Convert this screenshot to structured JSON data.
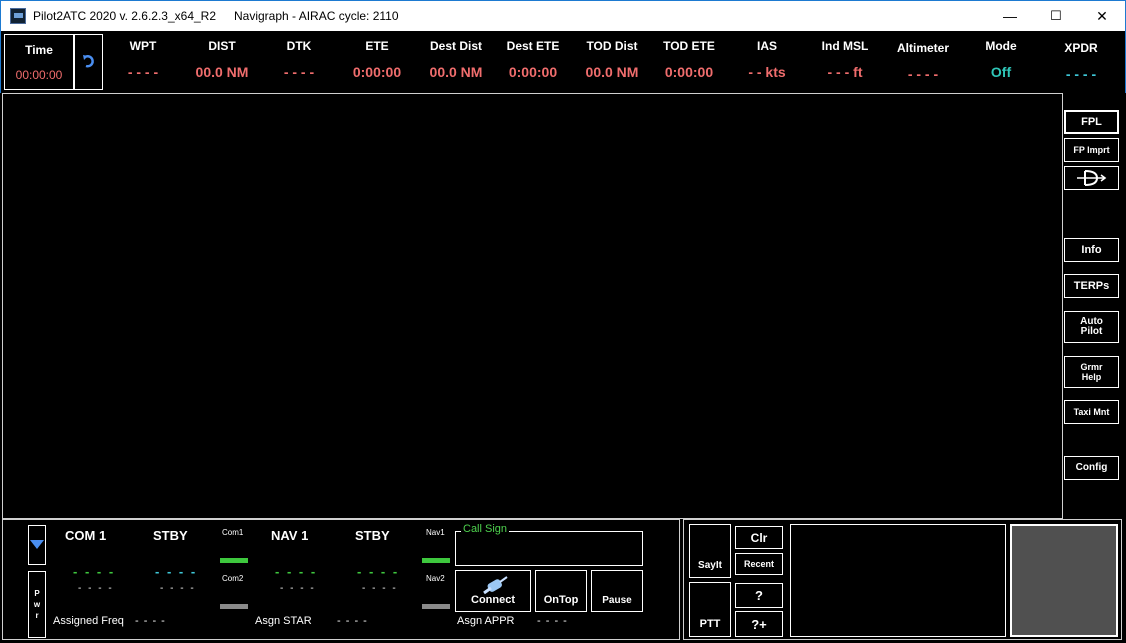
{
  "window": {
    "title": "Pilot2ATC 2020 v. 2.6.2.3_x64_R2",
    "subtitle": "Navigraph - AIRAC cycle: 2110",
    "minimize": "—",
    "maximize": "☐",
    "close": "✕"
  },
  "colors": {
    "value_red": "#f06d6d",
    "teal": "#2fc6b8",
    "green": "#3ec83e",
    "cyan": "#3ec8d8"
  },
  "instruments": {
    "time": {
      "label": "Time",
      "value": "00:00:00"
    },
    "refresh_icon": "refresh-icon",
    "columns": [
      {
        "key": "wpt",
        "label": "WPT",
        "value": "- - - -"
      },
      {
        "key": "dist",
        "label": "DIST",
        "value": "00.0 NM"
      },
      {
        "key": "dtk",
        "label": "DTK",
        "value": "- - - -"
      },
      {
        "key": "ete",
        "label": "ETE",
        "value": "0:00:00"
      },
      {
        "key": "dest-dist",
        "label": "Dest Dist",
        "value": "00.0 NM"
      },
      {
        "key": "dest-ete",
        "label": "Dest ETE",
        "value": "0:00:00"
      },
      {
        "key": "tod-dist",
        "label": "TOD Dist",
        "value": "00.0 NM"
      },
      {
        "key": "tod-ete",
        "label": "TOD ETE",
        "value": "0:00:00"
      },
      {
        "key": "ias",
        "label": "IAS",
        "value": "- - kts"
      },
      {
        "key": "ind-msl",
        "label": "Ind MSL",
        "value": "- - - ft"
      },
      {
        "key": "altimeter",
        "label": "Altimeter",
        "value": "- - - -"
      },
      {
        "key": "mode",
        "label": "Mode",
        "value": "Off"
      },
      {
        "key": "xpdr",
        "label": "XPDR",
        "value": "- - - -"
      }
    ]
  },
  "side_buttons": {
    "fpl": "FPL",
    "fp_import": "FP Imprt",
    "direct_to_icon": "direct-to-icon",
    "info": "Info",
    "terps": "TERPs",
    "auto_pilot_1": "Auto",
    "auto_pilot_2": "Pilot",
    "grmr_help_1": "Grmr",
    "grmr_help_2": "Help",
    "taxi_mnt": "Taxi Mnt",
    "config": "Config"
  },
  "radio": {
    "pwr": [
      "P",
      "w",
      "r"
    ],
    "com1_label": "COM 1",
    "com1_stby_label": "STBY",
    "com1_active": "- - - -",
    "com1_stby": "- - - -",
    "com2_active": "- - - -",
    "com2_stby": "- - - -",
    "com1_small": "Com1",
    "com2_small": "Com2",
    "nav1_label": "NAV 1",
    "nav1_stby_label": "STBY",
    "nav1_active": "- - - -",
    "nav1_stby": "- - - -",
    "nav2_active": "- - - -",
    "nav2_stby": "- - - -",
    "nav1_small": "Nav1",
    "nav2_small": "Nav2",
    "assigned_freq_label": "Assigned Freq",
    "assigned_freq_value": "- - - -",
    "asgn_star_label": "Asgn STAR",
    "asgn_star_value": "- - - -",
    "asgn_appr_label": "Asgn APPR",
    "asgn_appr_value": "- - - -",
    "call_sign_label": "Call Sign",
    "call_sign_value": "",
    "connect": "Connect",
    "on_top": "OnTop",
    "pause": "Pause"
  },
  "controls": {
    "sayit": "SayIt",
    "ptt": "PTT",
    "clr": "Clr",
    "recent": "Recent",
    "help": "?",
    "help_plus": "?+"
  }
}
